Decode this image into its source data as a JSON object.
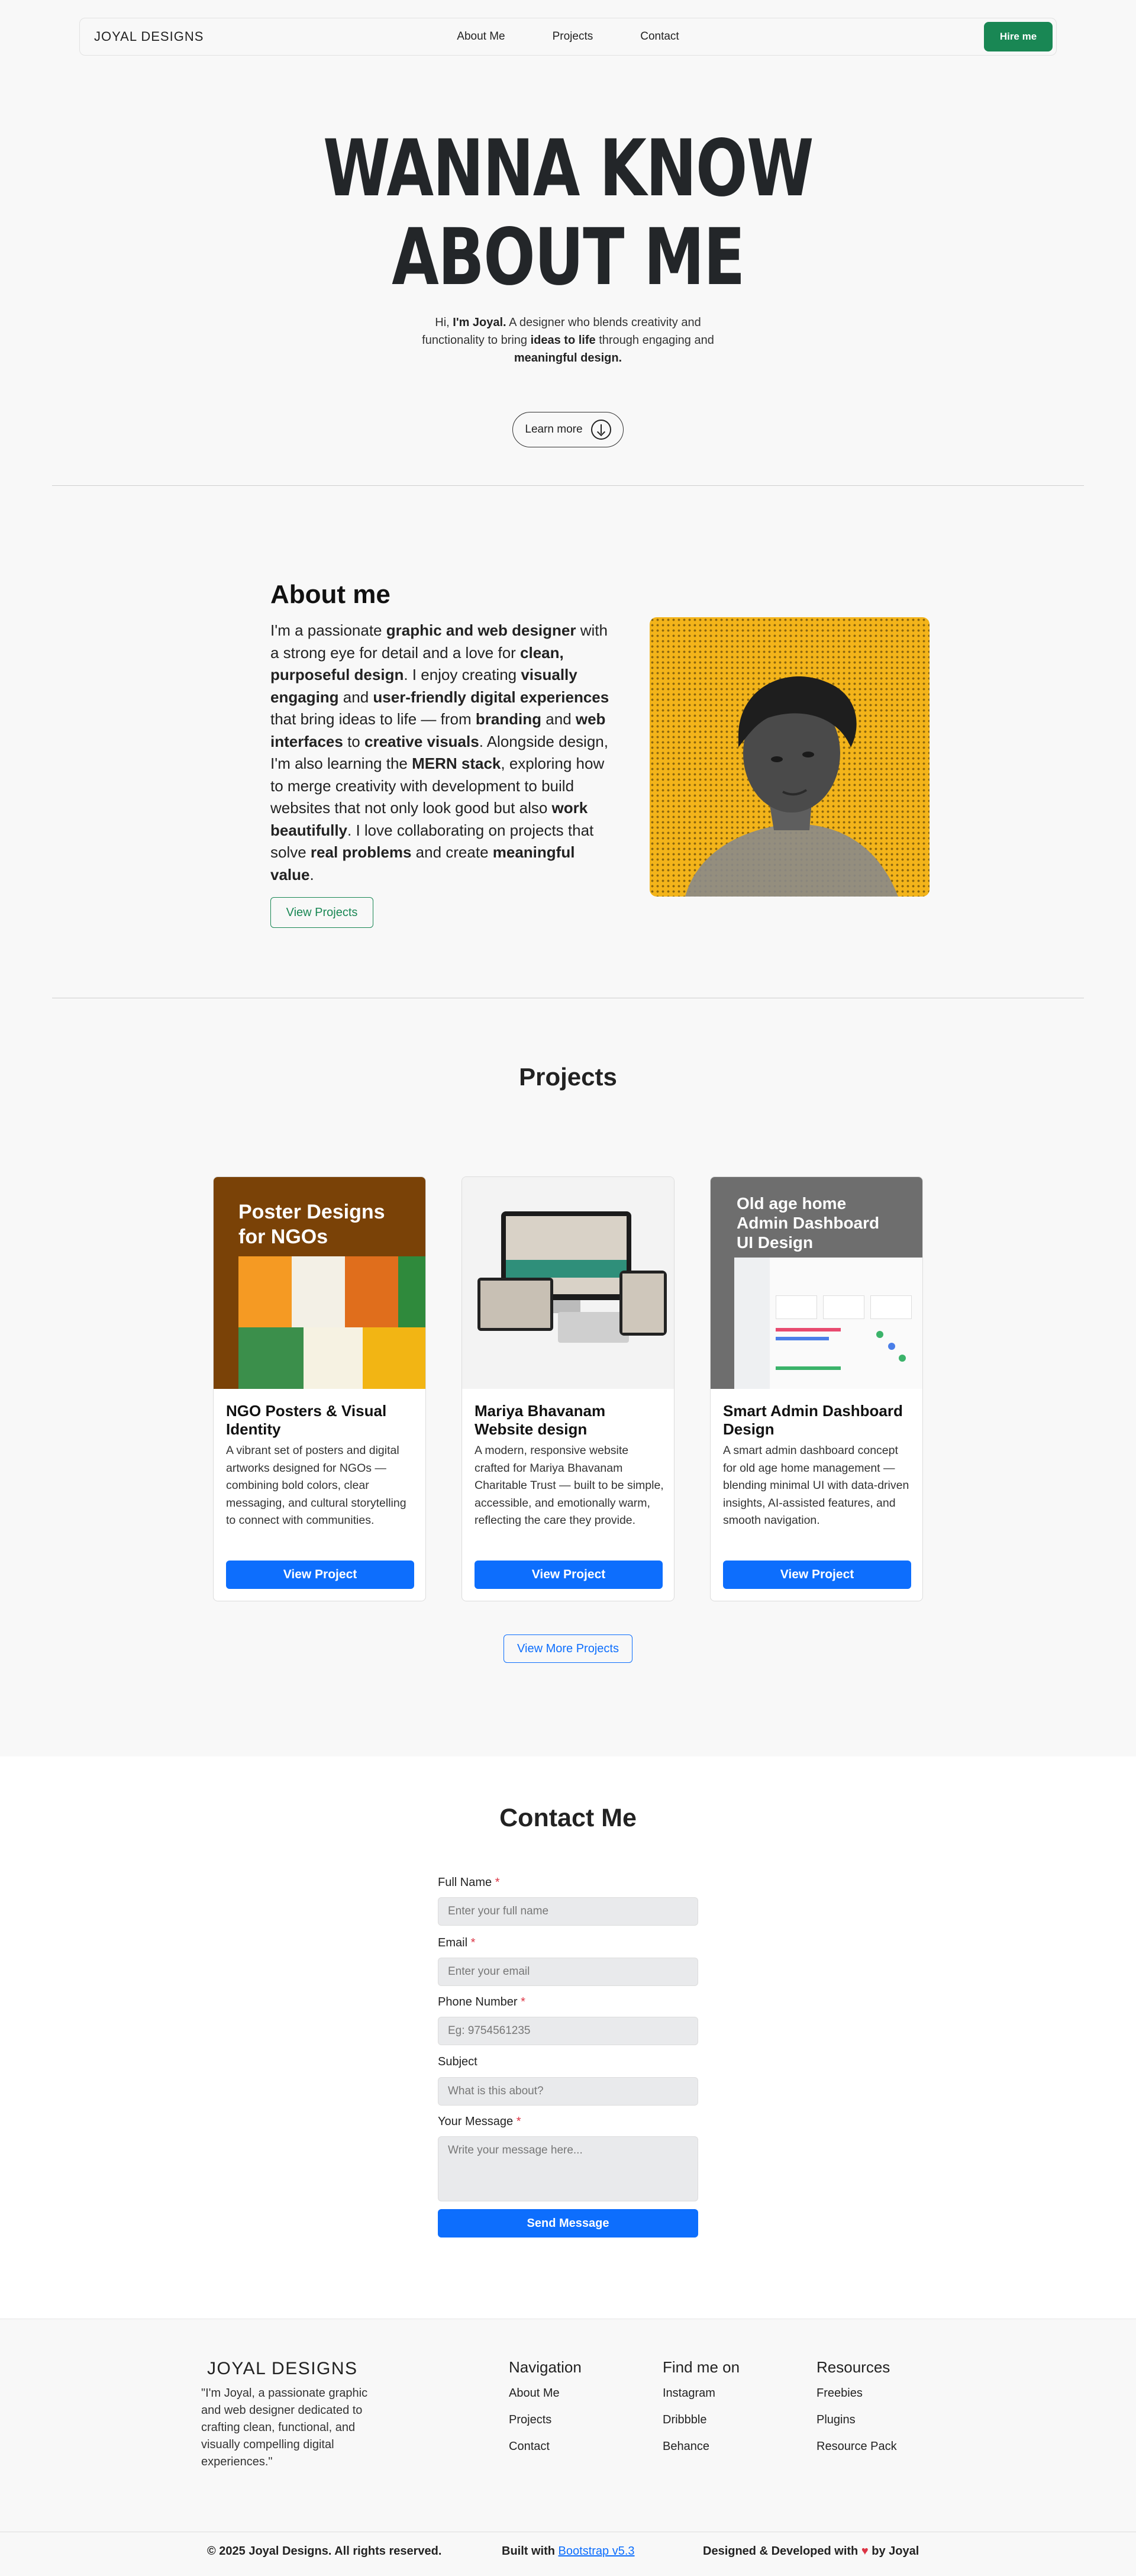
{
  "nav": {
    "brand": "JOYAL DESIGNS",
    "links": [
      "About Me",
      "Projects",
      "Contact"
    ],
    "hire": "Hire me"
  },
  "hero": {
    "title_line1": "WANNA KNOW",
    "title_line2": "ABOUT ME",
    "sub_1": "Hi, ",
    "sub_name": "I'm Joyal.",
    "sub_2": " A designer who blends creativity and functionality to bring ",
    "sub_bold1": "ideas to life",
    "sub_3": " through engaging and ",
    "sub_bold2": "meaningful design.",
    "learn_more": "Learn more"
  },
  "about": {
    "heading": "About me",
    "p": [
      "I'm a passionate ",
      "graphic and web designer",
      " with a strong eye for detail and a love for ",
      "clean, purposeful design",
      ". I enjoy creating ",
      "visually engaging",
      " and ",
      "user-friendly digital experiences",
      " that bring ideas to life — from ",
      "branding",
      " and ",
      "web interfaces",
      " to ",
      "creative visuals",
      ". Alongside design, I'm also learning the ",
      "MERN stack",
      ", exploring how to merge creativity with development to build websites that not only look good but also ",
      "work beautifully",
      ". I love collaborating on projects that solve ",
      "real problems",
      " and create ",
      "meaningful value",
      "."
    ],
    "button": "View Projects"
  },
  "projects": {
    "heading": "Projects",
    "cards": [
      {
        "thumb_text": "Poster Designs for NGOs",
        "title": "NGO Posters & Visual Identity",
        "desc": "A vibrant set of posters and digital artworks designed for NGOs — combining bold colors, clear messaging, and cultural storytelling to connect with communities.",
        "button": "View Project"
      },
      {
        "thumb_text": "",
        "title": "Mariya Bhavanam Website design",
        "desc": "A modern, responsive website crafted for Mariya Bhavanam Charitable Trust — built to be simple, accessible, and emotionally warm, reflecting the care they provide.",
        "button": "View Project"
      },
      {
        "thumb_text": "Old age home Admin Dashboard UI Design",
        "title": "Smart Admin Dashboard Design",
        "desc": "A smart admin dashboard concept for old age home management — blending minimal UI with data-driven insights, AI-assisted features, and smooth navigation.",
        "button": "View Project"
      }
    ],
    "more": "View More Projects"
  },
  "contact": {
    "heading": "Contact Me",
    "fields": [
      {
        "label": "Full Name",
        "required": "*",
        "placeholder": "Enter your full name"
      },
      {
        "label": "Email",
        "required": "*",
        "placeholder": "Enter your email"
      },
      {
        "label": "Phone Number",
        "required": "*",
        "placeholder": "Eg: 9754561235"
      },
      {
        "label": "Subject",
        "required": "",
        "placeholder": "What is this about?"
      },
      {
        "label": "Your Message",
        "required": "*",
        "placeholder": "Write your message here..."
      }
    ],
    "send": "Send Message"
  },
  "footer": {
    "brand": "JOYAL DESIGNS",
    "quote": "\"I'm Joyal, a passionate graphic and web designer dedicated to crafting clean, functional, and visually compelling digital experiences.\"",
    "columns": [
      {
        "heading": "Navigation",
        "links": [
          "About Me",
          "Projects",
          "Contact"
        ]
      },
      {
        "heading": "Find me on",
        "links": [
          "Instagram",
          "Dribbble",
          "Behance"
        ]
      },
      {
        "heading": "Resources",
        "links": [
          "Freebies",
          "Plugins",
          "Resource Pack"
        ]
      }
    ],
    "copyright": "© 2025 Joyal Designs. All rights reserved.",
    "built_prefix": "Built with ",
    "built_link": "Bootstrap v5.3",
    "designed_prefix": "Designed & Developed with ",
    "designed_suffix": " by Joyal"
  },
  "colors": {
    "primary": "#0d6efd",
    "success": "#198754",
    "photo_bg": "#f3b41a"
  }
}
